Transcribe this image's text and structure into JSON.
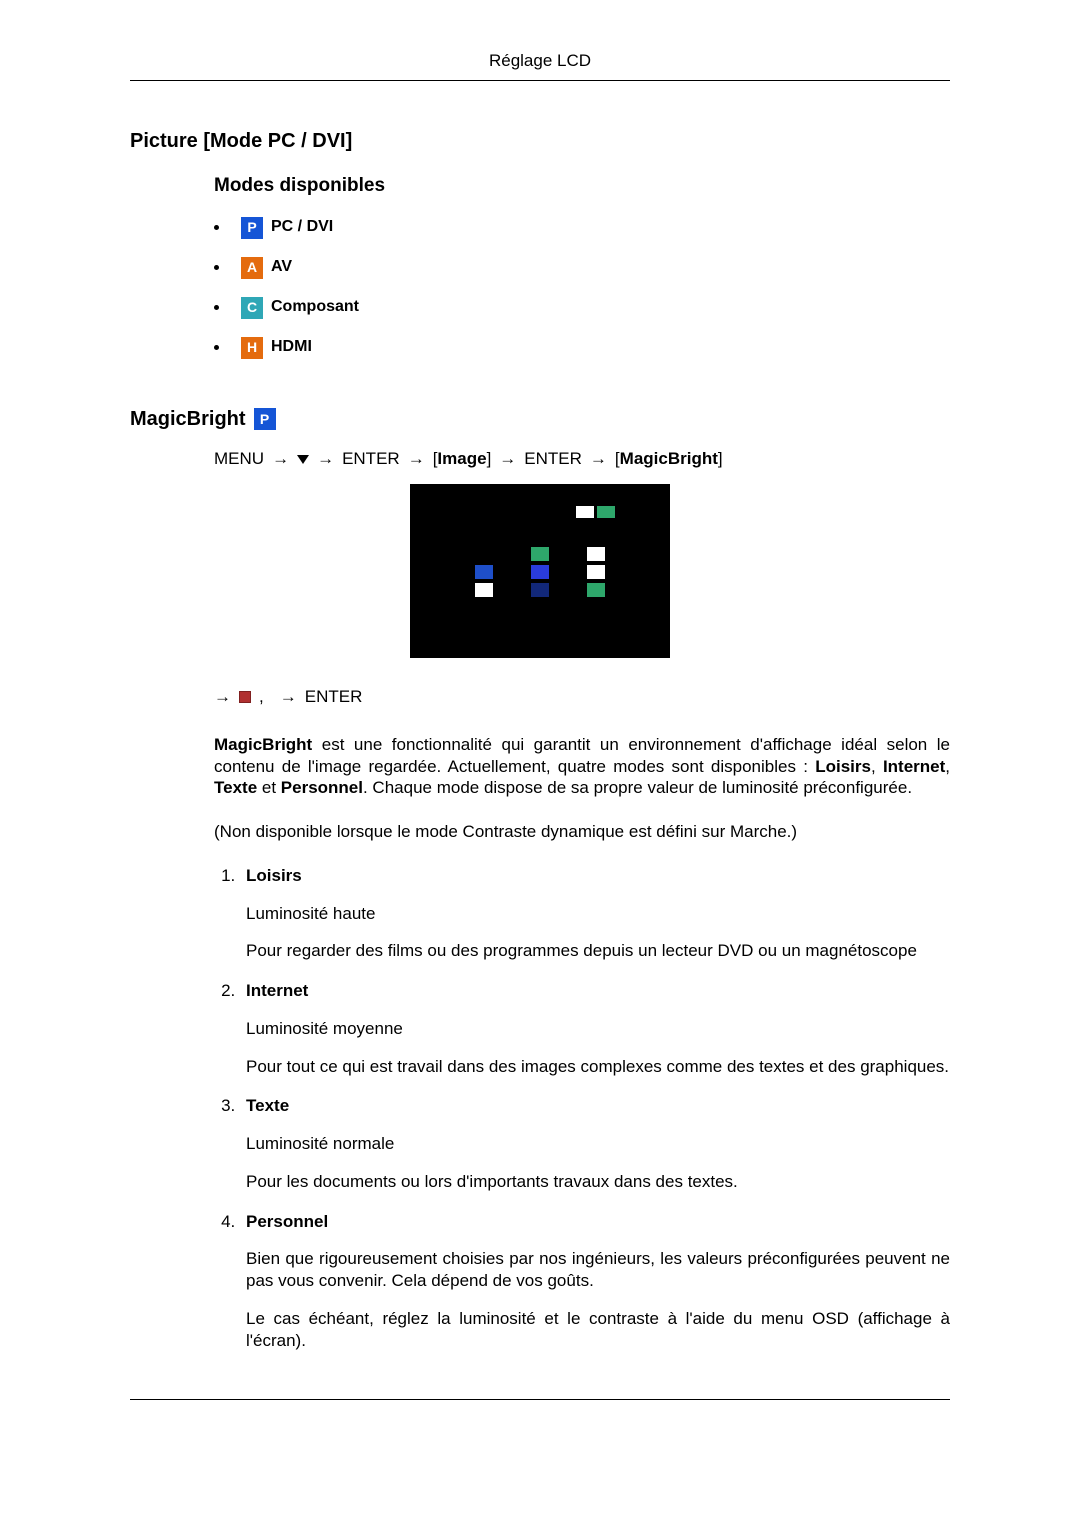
{
  "header": {
    "title": "Réglage LCD"
  },
  "section": {
    "title": "Picture [Mode PC / DVI]",
    "modes_heading": "Modes disponibles",
    "modes": [
      {
        "icon": "P",
        "color": "blue",
        "label": "PC / DVI"
      },
      {
        "icon": "A",
        "color": "orange",
        "label": "AV"
      },
      {
        "icon": "C",
        "color": "cyan",
        "label": "Composant"
      },
      {
        "icon": "H",
        "color": "orange",
        "label": "HDMI"
      }
    ]
  },
  "magicbright": {
    "title": "MagicBright",
    "breadcrumb1": {
      "menu": "MENU",
      "enter1": "ENTER",
      "image": "Image",
      "enter2": "ENTER",
      "magicbright": "MagicBright"
    },
    "breadcrumb2": {
      "enter": "ENTER"
    },
    "para1_pre": "MagicBright",
    "para1_post": " est une fonctionnalité qui garantit un environnement d'affichage idéal selon le contenu de l'image regardée. Actuellement, quatre modes sont disponibles : ",
    "para1_modes": [
      "Loisirs",
      "Internet",
      "Texte",
      "Personnel"
    ],
    "para1_tail": ". Chaque mode dispose de sa propre valeur de luminosité préconfigurée.",
    "note_pre": "(Non disponible lorsque le mode ",
    "note_mid": "Contraste dynamique",
    "note_mid2": " est défini sur ",
    "note_end": "Marche",
    "note_tail": ".)",
    "items": [
      {
        "title": "Loisirs",
        "lines": [
          "Luminosité haute",
          "Pour regarder des films ou des programmes depuis un lecteur DVD ou un magnétoscope"
        ]
      },
      {
        "title": "Internet",
        "lines": [
          "Luminosité moyenne",
          "Pour tout ce qui est travail dans des images complexes comme des textes et des graphiques."
        ]
      },
      {
        "title": "Texte",
        "lines": [
          "Luminosité normale",
          "Pour les documents ou lors d'importants travaux dans des textes."
        ]
      },
      {
        "title": "Personnel",
        "lines": [
          "Bien que rigoureusement choisies par nos ingénieurs, les valeurs préconfigurées peuvent ne pas vous convenir. Cela dépend de vos goûts.",
          "Le cas échéant, réglez la luminosité et le contraste à l'aide du menu OSD (affichage à l'écran)."
        ]
      }
    ]
  }
}
